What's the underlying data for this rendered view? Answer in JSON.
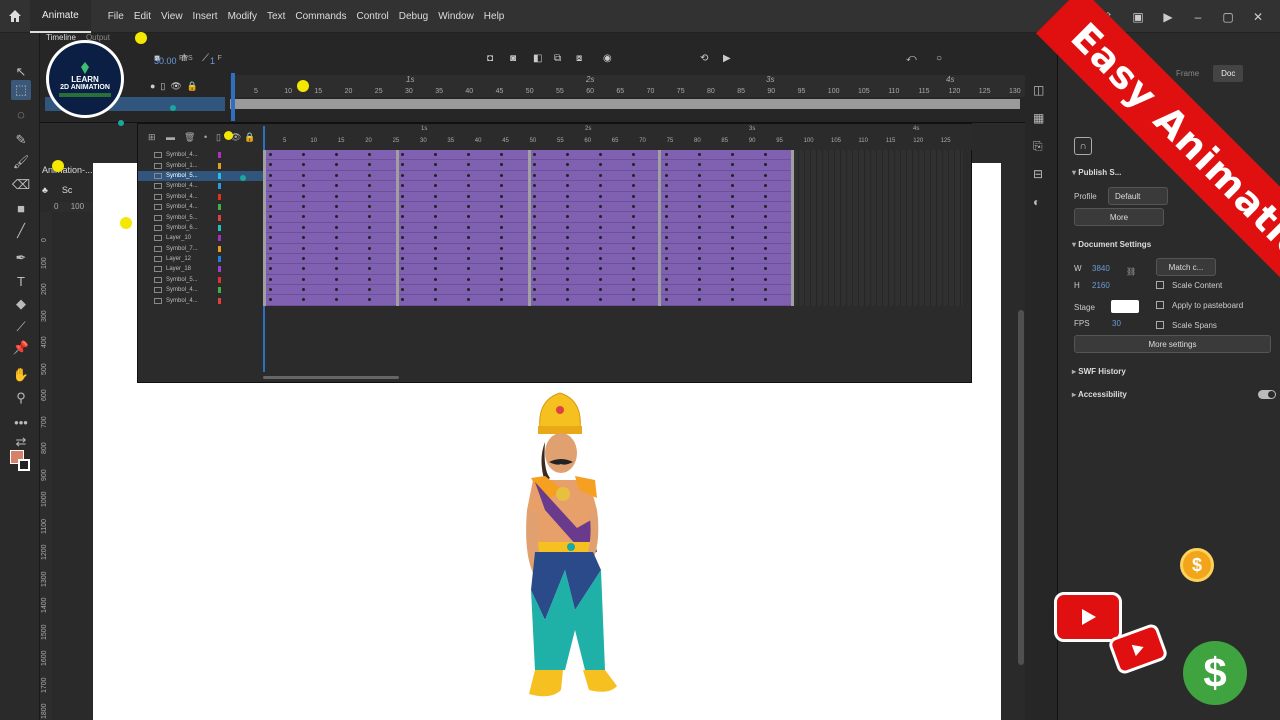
{
  "menubar": {
    "app_tab": "Animate",
    "items": [
      "File",
      "Edit",
      "View",
      "Insert",
      "Modify",
      "Text",
      "Commands",
      "Control",
      "Debug",
      "Window",
      "Help"
    ]
  },
  "timeline": {
    "tab": "Timeline",
    "tab2": "Output",
    "fps": "30.00",
    "fps_unit": "FPS",
    "frame": "1",
    "frame_unit": "F",
    "ticks": [
      "5",
      "10",
      "15",
      "20",
      "25",
      "30",
      "35",
      "40",
      "45",
      "50",
      "55",
      "60",
      "65",
      "70",
      "75",
      "80",
      "85",
      "90",
      "95",
      "100",
      "105",
      "110",
      "115",
      "120",
      "125",
      "130"
    ],
    "seconds": [
      "1s",
      "2s",
      "3s",
      "4s"
    ]
  },
  "nested_timeline": {
    "ticks": [
      "5",
      "10",
      "15",
      "20",
      "25",
      "30",
      "35",
      "40",
      "45",
      "50",
      "55",
      "60",
      "65",
      "70",
      "75",
      "80",
      "85",
      "90",
      "95",
      "100",
      "105",
      "110",
      "115",
      "120",
      "125"
    ],
    "seconds": [
      "1s",
      "2s",
      "3s",
      "4s"
    ],
    "layers": [
      {
        "name": "Symbol_4...",
        "color": "#b030c0"
      },
      {
        "name": "Symbol_1...",
        "color": "#e0a020"
      },
      {
        "name": "Symbol_5...",
        "color": "#20c0e0",
        "selected": true
      },
      {
        "name": "Symbol_4...",
        "color": "#20a0e0"
      },
      {
        "name": "Symbol_4...",
        "color": "#e03020"
      },
      {
        "name": "Symbol_4...",
        "color": "#40b040"
      },
      {
        "name": "Symbol_5...",
        "color": "#e04040"
      },
      {
        "name": "Symbol_6...",
        "color": "#20c0c0"
      },
      {
        "name": "Layer_10",
        "color": "#a030c0"
      },
      {
        "name": "Symbol_7...",
        "color": "#e0a020"
      },
      {
        "name": "Layer_12",
        "color": "#2080e0"
      },
      {
        "name": "Layer_18",
        "color": "#a040d0"
      },
      {
        "name": "Symbol_5...",
        "color": "#e03030"
      },
      {
        "name": "Symbol_4...",
        "color": "#40b040"
      },
      {
        "name": "Symbol_4...",
        "color": "#e04040"
      }
    ]
  },
  "stage": {
    "scene_label": "Animation-...",
    "scene_short": "Sc",
    "zoom_h": "100",
    "ruler_v": [
      "0",
      "100",
      "200",
      "300",
      "400",
      "500",
      "600",
      "700",
      "800",
      "900",
      "1000",
      "1100",
      "1200",
      "1300",
      "1400",
      "1500",
      "1600",
      "1700",
      "1800"
    ]
  },
  "properties": {
    "tab_frame": "Frame",
    "tab_doc": "Doc",
    "publish_settings": "Publish S...",
    "profile_label": "Profile",
    "profile_value": "Default",
    "more_btn": "More",
    "doc_settings": "Document Settings",
    "w_label": "W",
    "w_value": "3840",
    "h_label": "H",
    "h_value": "2160",
    "match_btn": "Match c...",
    "scale_content": "Scale Content",
    "stage_label": "Stage",
    "apply_pasteboard": "Apply to pasteboard",
    "fps_label": "FPS",
    "fps_value": "30",
    "scale_spans": "Scale Spans",
    "more_settings": "More settings",
    "swf_history": "SWF History",
    "accessibility": "Accessibility"
  },
  "overlay": {
    "banner": "Easy Animation",
    "logo_line1": "LEARN",
    "logo_line2": "2D ANIMATION",
    "coin_symbol": "$",
    "dollar_symbol": "$"
  },
  "colors": {
    "frames_purple": "#8060b0",
    "banner_red": "#e01010",
    "selection_blue": "#30567e",
    "accent_blue": "#6a9bd8"
  }
}
